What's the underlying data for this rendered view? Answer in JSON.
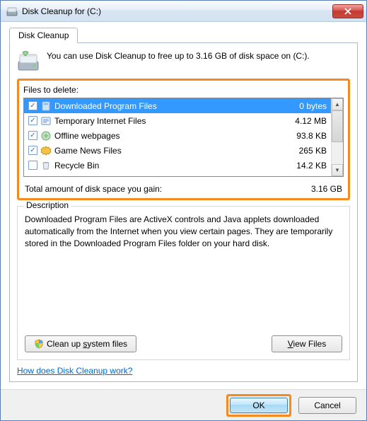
{
  "title": "Disk Cleanup for  (C:)",
  "tab_label": "Disk Cleanup",
  "intro": "You can use Disk Cleanup to free up to 3.16 GB of disk space on (C:).",
  "files_label": "Files to delete:",
  "files": [
    {
      "checked": true,
      "name": "Downloaded Program Files",
      "size": "0 bytes",
      "selected": true
    },
    {
      "checked": true,
      "name": "Temporary Internet Files",
      "size": "4.12 MB",
      "selected": false
    },
    {
      "checked": true,
      "name": "Offline webpages",
      "size": "93.8 KB",
      "selected": false
    },
    {
      "checked": true,
      "name": "Game News Files",
      "size": "265 KB",
      "selected": false
    },
    {
      "checked": false,
      "name": "Recycle Bin",
      "size": "14.2 KB",
      "selected": false
    }
  ],
  "total_label": "Total amount of disk space you gain:",
  "total_value": "3.16 GB",
  "description_legend": "Description",
  "description_text": "Downloaded Program Files are ActiveX controls and Java applets downloaded automatically from the Internet when you view certain pages. They are temporarily stored in the Downloaded Program Files folder on your hard disk.",
  "cleanup_btn_pre": "Clean up ",
  "cleanup_btn_u": "s",
  "cleanup_btn_post": "ystem files",
  "view_btn_u": "V",
  "view_btn_post": "iew Files",
  "help_link": "How does Disk Cleanup work?",
  "ok": "OK",
  "cancel": "Cancel"
}
